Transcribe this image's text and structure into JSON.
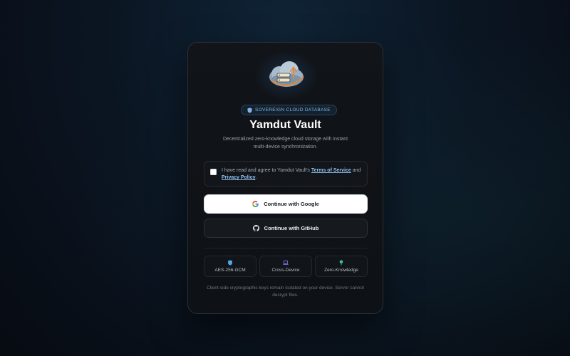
{
  "hero": {
    "badge": "SOVEREIGN CLOUD DATABASE",
    "title": "Yamdut Vault",
    "subtitle": "Decentralized zero-knowledge cloud storage with instant multi-device synchronization."
  },
  "consent": {
    "prefix": "I have read and agree to Yamdut Vault's ",
    "terms_link": "Terms of Service",
    "middle": " and ",
    "privacy_link": "Privacy Policy",
    "suffix": "."
  },
  "auth": {
    "google_label": "Continue with Google",
    "github_label": "Continue with GitHub"
  },
  "features": [
    {
      "label": "AES-256-GCM",
      "icon": "shield-icon",
      "color": "#4fa7e8"
    },
    {
      "label": "Cross-Device",
      "icon": "laptop-icon",
      "color": "#8b7cf0"
    },
    {
      "label": "Zero-Knowledge",
      "icon": "tree-icon",
      "color": "#3fbf8a"
    }
  ],
  "footnote": "Client-side cryptographic keys remain isolated on your device. Server cannot decrypt files.",
  "colors": {
    "accent": "#8ec1f0",
    "badge_text": "#7fb6e6",
    "card_bg": "#111418"
  }
}
